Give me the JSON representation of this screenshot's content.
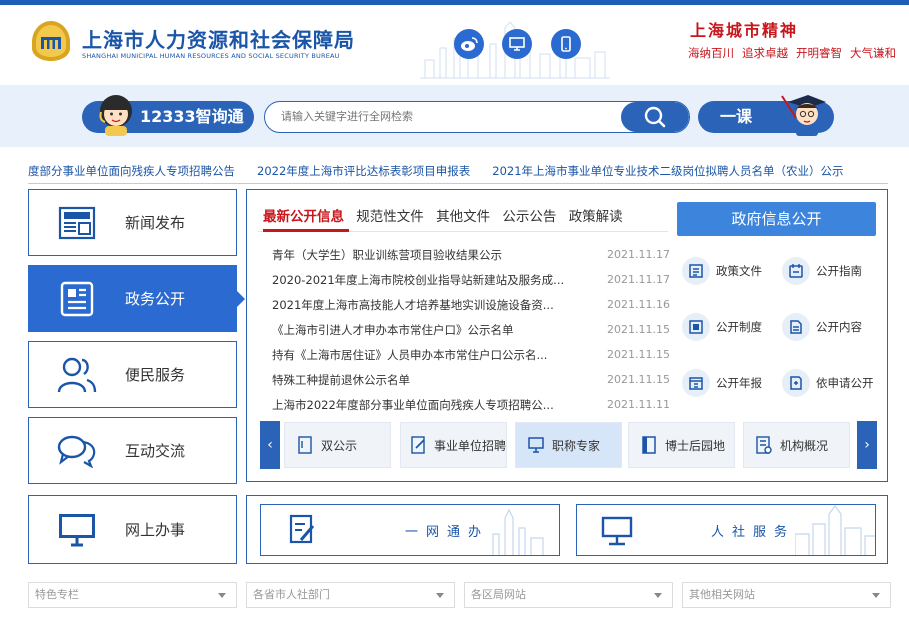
{
  "header": {
    "title": "上海市人力资源和社会保障局",
    "subtitle": "SHANGHAI MUNICIPAL HUMAN RESOURCES AND SOCIAL SECURITY BUREAU",
    "icons": [
      "weibo-icon",
      "monitor-icon",
      "mobile-icon"
    ],
    "spirit_title": "上海城市精神",
    "spirit_words": [
      "海纳百川",
      "追求卓越",
      "开明睿智",
      "大气谦和"
    ]
  },
  "search": {
    "assistant_label": "12333智询通",
    "placeholder": "请输入关键字进行全网检索",
    "yike_label": "一课"
  },
  "ticker": [
    "度部分事业单位面向残疾人专项招聘公告",
    "2022年度上海市评比达标表彰项目申报表",
    "2021年上海市事业单位专业技术二级岗位拟聘人员名单（农业）公示"
  ],
  "nav": [
    {
      "label": "新闻发布",
      "icon": "news-icon"
    },
    {
      "label": "政务公开",
      "icon": "document-icon"
    },
    {
      "label": "便民服务",
      "icon": "people-icon"
    },
    {
      "label": "互动交流",
      "icon": "chat-icon"
    }
  ],
  "tabs": [
    "最新公开信息",
    "规范性文件",
    "其他文件",
    "公示公告",
    "政策解读"
  ],
  "news": [
    {
      "title": "青年（大学生）职业训练营项目验收结果公示",
      "date": "2021.11.17"
    },
    {
      "title": "2020-2021年度上海市院校创业指导站新建站及服务成...",
      "date": "2021.11.17"
    },
    {
      "title": "2021年度上海市高技能人才培养基地实训设施设备资...",
      "date": "2021.11.16"
    },
    {
      "title": "《上海市引进人才申办本市常住户口》公示名单",
      "date": "2021.11.15"
    },
    {
      "title": "持有《上海市居住证》人员申办本市常住户口公示名...",
      "date": "2021.11.15"
    },
    {
      "title": "特殊工种提前退休公示名单",
      "date": "2021.11.15"
    },
    {
      "title": "上海市2022年度部分事业单位面向残疾人专项招聘公...",
      "date": "2021.11.11"
    }
  ],
  "gov": {
    "button": "政府信息公开",
    "items": [
      "政策文件",
      "公开指南",
      "公开制度",
      "公开内容",
      "公开年报",
      "依申请公开"
    ]
  },
  "chips": [
    "双公示",
    "事业单位招聘",
    "职称专家",
    "博士后园地",
    "机构概况"
  ],
  "online": {
    "label": "网上办事",
    "banners": [
      "一网通办",
      "人社服务"
    ]
  },
  "selects": [
    "特色专栏",
    "各省市人社部门",
    "各区局网站",
    "其他相关网站"
  ],
  "colors": {
    "primary": "#2a63b8",
    "accent": "#c8161d",
    "band": "#e8f1fb"
  }
}
